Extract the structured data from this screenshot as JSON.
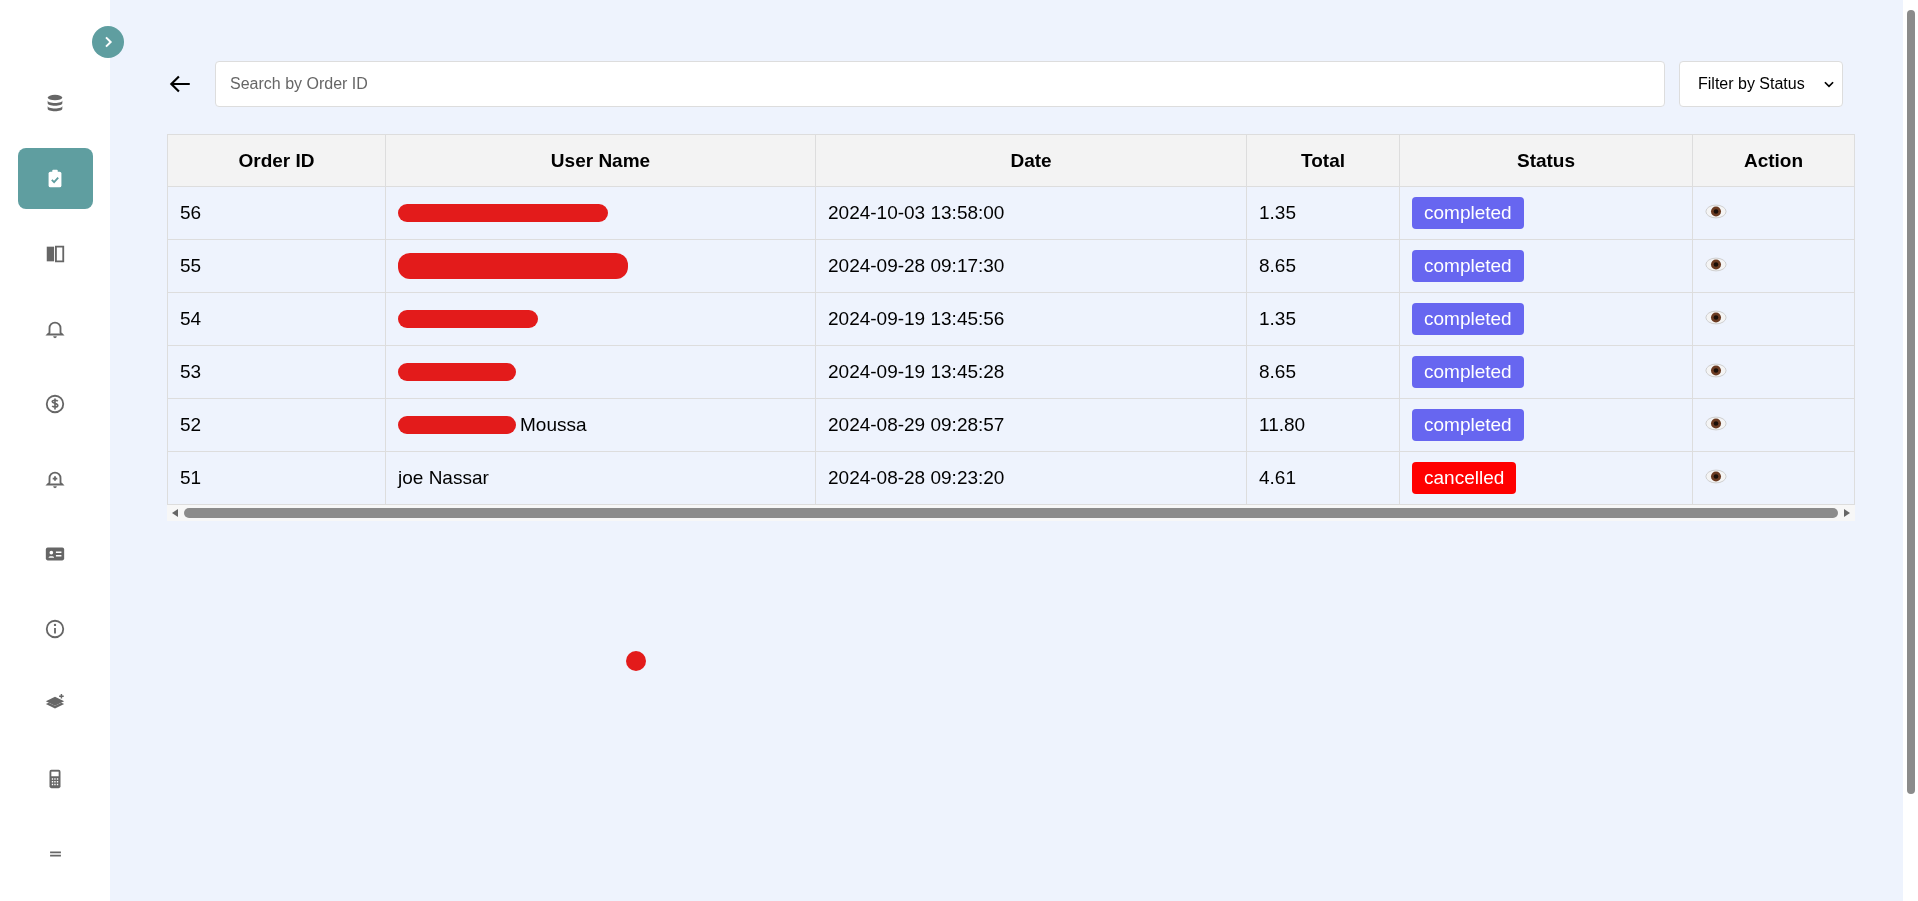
{
  "sidebar": {
    "items": [
      {
        "selected": false
      },
      {
        "selected": true
      },
      {
        "selected": false
      },
      {
        "selected": false
      },
      {
        "selected": false
      },
      {
        "selected": false
      },
      {
        "selected": false
      },
      {
        "selected": false
      },
      {
        "selected": false
      },
      {
        "selected": false
      },
      {
        "selected": false
      }
    ]
  },
  "search": {
    "placeholder": "Search by Order ID"
  },
  "filter": {
    "value": "Filter by Status"
  },
  "table": {
    "columns": [
      "Order ID",
      "User Name",
      "Date",
      "Total",
      "Status",
      "Action"
    ],
    "rows": [
      {
        "order_id": "56",
        "redacted": true,
        "date": "2024-10-03 13:58:00",
        "total": "1.35",
        "status": "completed",
        "kind": "completed"
      },
      {
        "order_id": "55",
        "redacted": true,
        "date": "2024-09-28 09:17:30",
        "total": "8.65",
        "status": "completed",
        "kind": "completed"
      },
      {
        "order_id": "54",
        "redacted": true,
        "date": "2024-09-19 13:45:56",
        "total": "1.35",
        "status": "completed",
        "kind": "completed"
      },
      {
        "order_id": "53",
        "redacted": true,
        "date": "2024-09-19 13:45:28",
        "total": "8.65",
        "status": "completed",
        "kind": "completed"
      },
      {
        "order_id": "52",
        "redacted": true,
        "user_name": "Moussa",
        "date": "2024-08-29 09:28:57",
        "total": "11.80",
        "status": "completed",
        "kind": "completed"
      },
      {
        "order_id": "51",
        "redacted": false,
        "user_name": "joe Nassar",
        "date": "2024-08-28 09:23:20",
        "total": "4.61",
        "status": "cancelled",
        "kind": "cancelled"
      }
    ]
  }
}
